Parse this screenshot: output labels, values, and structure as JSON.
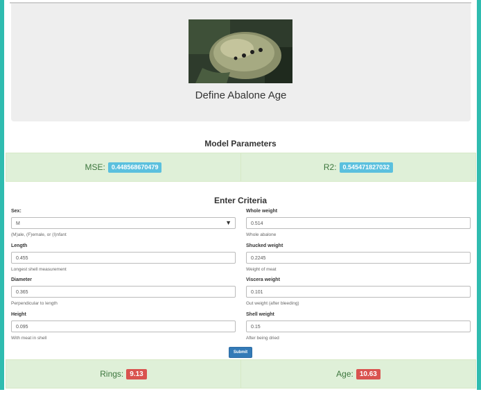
{
  "hero": {
    "title": "Define Abalone Age"
  },
  "model": {
    "heading": "Model Parameters",
    "mse_label": "MSE:",
    "mse_value": "0.448568670479",
    "r2_label": "R2:",
    "r2_value": "0.545471827032"
  },
  "criteria": {
    "heading": "Enter Criteria",
    "fields": {
      "sex": {
        "label": "Sex:",
        "value": "M",
        "help": "(M)ale, (F)emale, or (I)nfant"
      },
      "length": {
        "label": "Length",
        "value": "0.455",
        "help": "Longest shell measurement"
      },
      "diameter": {
        "label": "Diameter",
        "value": "0.365",
        "help": "Perpendicular to length"
      },
      "height": {
        "label": "Height",
        "value": "0.095",
        "help": "With meat in shell"
      },
      "whole_weight": {
        "label": "Whole weight",
        "value": "0.514",
        "help": "Whole abalone"
      },
      "shucked_weight": {
        "label": "Shucked weight",
        "value": "0.2245",
        "help": "Weight of meat"
      },
      "viscera_weight": {
        "label": "Viscera weight",
        "value": "0.101",
        "help": "Gut weight (after bleeding)"
      },
      "shell_weight": {
        "label": "Shell weight",
        "value": "0.15",
        "help": "After being dried"
      }
    },
    "submit_label": "Submit"
  },
  "results": {
    "rings_label": "Rings:",
    "rings_value": "9.13",
    "age_label": "Age:",
    "age_value": "10.63"
  },
  "colors": {
    "frame": "#2fbcb0",
    "well_bg": "#dff0d8",
    "info_badge": "#5bc0de",
    "danger_badge": "#d9534f",
    "primary_button": "#337ab7"
  }
}
